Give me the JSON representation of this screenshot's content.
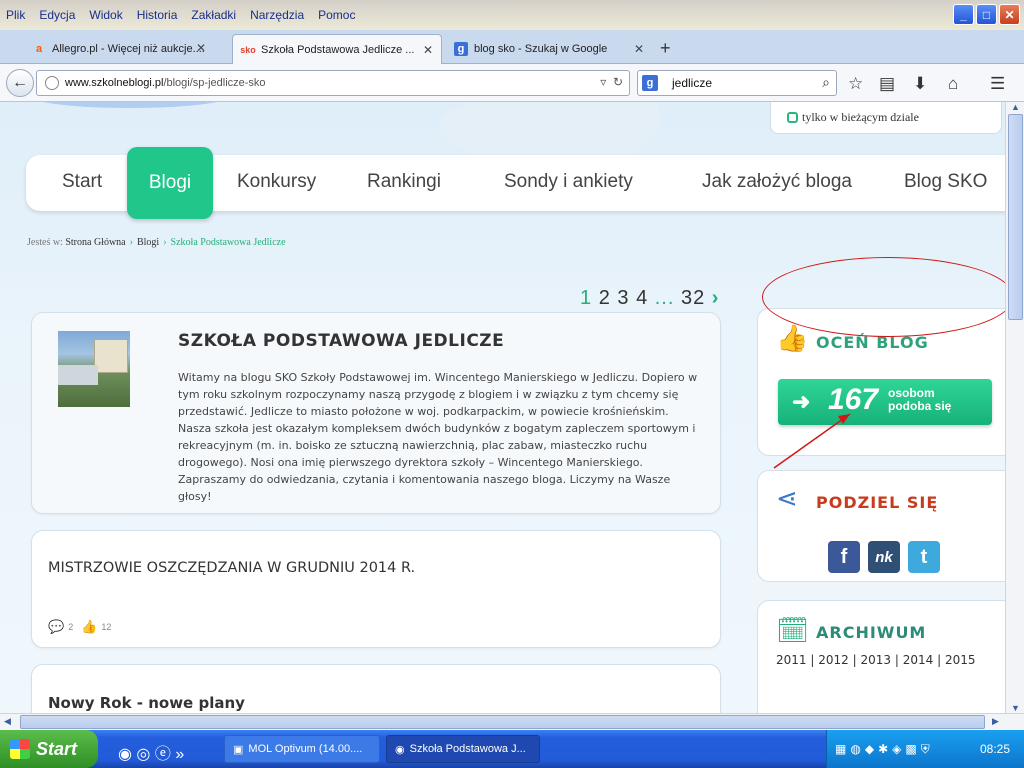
{
  "menu": [
    "Plik",
    "Edycja",
    "Widok",
    "Historia",
    "Zakładki",
    "Narzędzia",
    "Pomoc"
  ],
  "window_buttons": {
    "minimize": "_",
    "maximize": "□",
    "close": "✕"
  },
  "tabs": [
    {
      "label": "Allegro.pl - Więcej niż aukcje....",
      "icon": "allegro-icon",
      "icon_text": "a",
      "color": "#ff5a00"
    },
    {
      "label": "Szkoła Podstawowa Jedlicze ...",
      "icon": "sko-icon",
      "icon_text": "sko",
      "color": "#e3422b",
      "active": true
    },
    {
      "label": "blog sko - Szukaj w Google",
      "icon": "google-icon",
      "icon_text": "g",
      "color": "#3b6fd6"
    }
  ],
  "navbar": {
    "url_host": "www.szkolneblogi.pl",
    "url_path": "/blogi/sp-jedlicze-sko",
    "search_value": "jedlicze"
  },
  "site": {
    "search_option": "tylko w bieżącym dziale",
    "nav": [
      "Start",
      "Blogi",
      "Konkursy",
      "Rankingi",
      "Sondy i ankiety",
      "Jak założyć bloga",
      "Blog SKO"
    ],
    "breadcrumb": {
      "prefix": "Jesteś w:",
      "home": "Strona Główna",
      "section": "Blogi",
      "current": "Szkoła Podstawowa Jedlicze"
    },
    "pager": {
      "current": "1",
      "pages": [
        "2",
        "3",
        "4"
      ],
      "dots": "...",
      "last": "32",
      "next": "›"
    }
  },
  "intro": {
    "title": "szkoła podstawowa jedlicze",
    "text": "Witamy na blogu SKO Szkoły Podstawowej im. Wincentego Manierskiego w Jedliczu. Dopiero w tym roku szkolnym rozpoczynamy naszą przygodę z blogiem i w związku z tym chcemy się przedstawić. Jedlicze to miasto położone w woj. podkarpackim, w powiecie krośnieńskim. Nasza szkoła jest okazałym kompleksem dwóch budynków z bogatym zapleczem sportowym i rekreacyjnym (m. in. boisko ze sztuczną nawierzchnią, plac zabaw, miasteczko ruchu drogowego). Nosi ona imię pierwszego dyrektora szkoły – Wincentego Manierskiego. Zapraszamy do odwiedzania, czytania i komentowania naszego bloga. Liczymy na Wasze głosy!"
  },
  "posts": [
    {
      "title": "MISTRZOWIE OSZCZĘDZANIA W GRUDNIU 2014 R.",
      "comments": "2",
      "likes": "12"
    },
    {
      "title": "Nowy Rok - nowe plany"
    }
  ],
  "sidebar": {
    "rate": {
      "title": "oceń blog",
      "count": "167",
      "label_line1": "osobom",
      "label_line2": "podoba się"
    },
    "share": {
      "title": "podziel się",
      "networks": [
        {
          "icon": "facebook-icon",
          "glyph": "f",
          "color": "#3b5998"
        },
        {
          "icon": "nk-icon",
          "glyph": "nk",
          "color": "#2f4f74"
        },
        {
          "icon": "twitter-icon",
          "glyph": "t",
          "color": "#3ea9dd"
        }
      ]
    },
    "archive": {
      "title": "archiwum",
      "years": [
        "2011",
        "2012",
        "2013",
        "2014",
        "2015"
      ],
      "separator": "|"
    }
  },
  "colors": {
    "accent": "#22b07a",
    "title_rate": "#2ea37a",
    "title_share": "#c73b1e",
    "title_archive": "#2c8c77",
    "annotation": "#d01818"
  },
  "taskbar": {
    "start": "Start",
    "tasks": [
      {
        "label": "MOL Optivum (14.00....",
        "icon": "mol-icon"
      },
      {
        "label": "Szkoła Podstawowa J...",
        "icon": "firefox-icon",
        "active": true
      }
    ],
    "quick_launch_more": "»",
    "clock": "08:25"
  }
}
